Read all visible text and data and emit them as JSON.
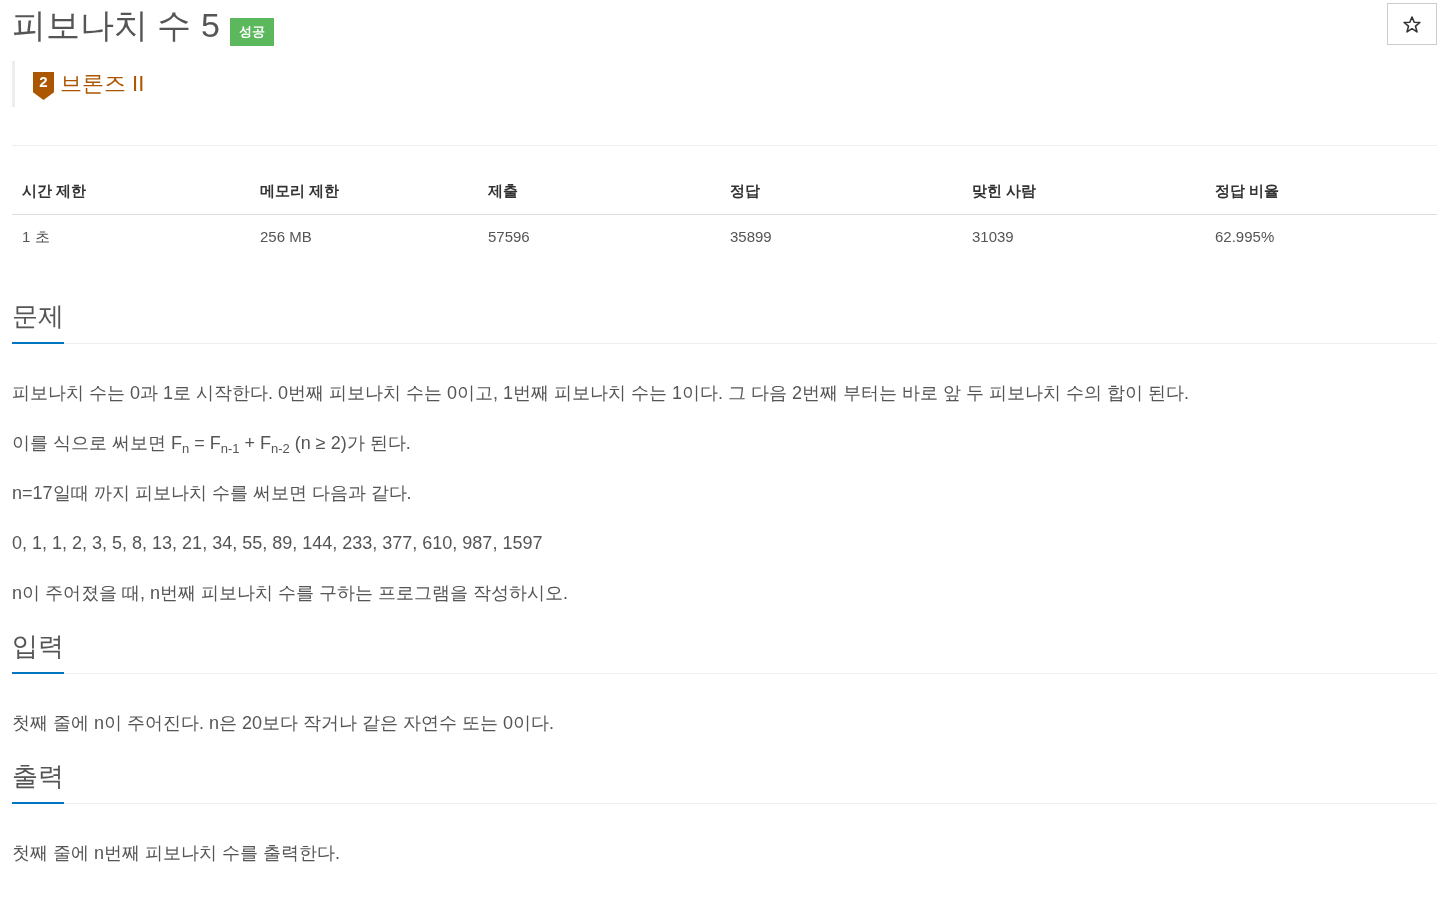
{
  "problem": {
    "title": "피보나치 수 5",
    "status_badge": "성공",
    "tier": {
      "number": "2",
      "name": "브론즈 II"
    }
  },
  "favorite": {
    "starred": false
  },
  "stats_table": {
    "columns": [
      "시간 제한",
      "메모리 제한",
      "제출",
      "정답",
      "맞힌 사람",
      "정답 비율"
    ],
    "rows": [
      [
        "1 초",
        "256 MB",
        "57596",
        "35899",
        "31039",
        "62.995%"
      ]
    ]
  },
  "sections": [
    {
      "heading": "문제",
      "paragraphs": [
        "피보나치 수는 0과 1로 시작한다. 0번째 피보나치 수는 0이고, 1번째 피보나치 수는 1이다. 그 다음 2번째 부터는 바로 앞 두 피보나치 수의 합이 된다.",
        "이를 식으로 써보면 F$_{n}$ = F$_{n-1}$ + F$_{n-2}$ (n ≥ 2)가 된다.",
        "n=17일때 까지 피보나치 수를 써보면 다음과 같다.",
        "0, 1, 1, 2, 3, 5, 8, 13, 21, 34, 55, 89, 144, 233, 377, 610, 987, 1597",
        "n이 주어졌을 때, n번째 피보나치 수를 구하는 프로그램을 작성하시오."
      ]
    },
    {
      "heading": "입력",
      "paragraphs": [
        "첫째 줄에 n이 주어진다. n은 20보다 작거나 같은 자연수 또는 0이다."
      ]
    },
    {
      "heading": "출력",
      "paragraphs": [
        "첫째 줄에 n번째 피보나치 수를 출력한다."
      ]
    }
  ]
}
